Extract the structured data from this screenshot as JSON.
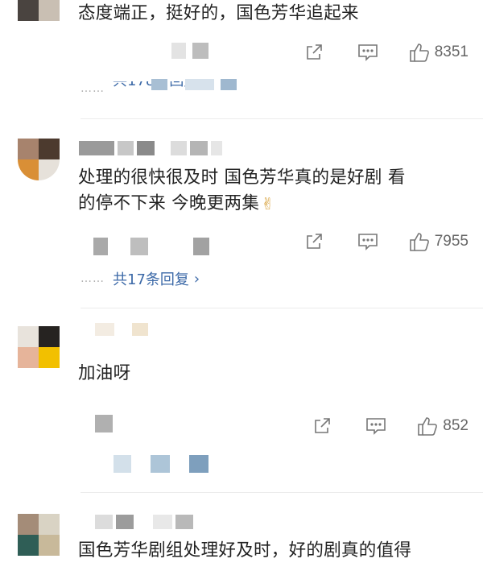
{
  "comments": [
    {
      "text": "态度端正，挺好的，国色芳华追起来",
      "actions": {
        "share_icon": "share-icon",
        "comment_icon": "comment-icon",
        "like_icon": "thumbs-up-icon",
        "like_count": "8351"
      },
      "replies_label": "共178条回复",
      "replies_arrow": "›"
    },
    {
      "text_line1": "处理的很快很及时 国色芳华真的是好剧 看",
      "text_line2": "的停不下来 今晚更两集",
      "emoji": "✌",
      "actions": {
        "like_count": "7955"
      },
      "replies_label": "共17条回复",
      "replies_arrow": "›"
    },
    {
      "text": "加油呀",
      "actions": {
        "like_count": "852"
      }
    },
    {
      "text": "国色芳华剧组处理好及时，好的剧真的值得"
    }
  ],
  "colors": {
    "link": "#3d6aa8",
    "text": "#222222",
    "meta": "#666666",
    "icon": "#777777"
  }
}
